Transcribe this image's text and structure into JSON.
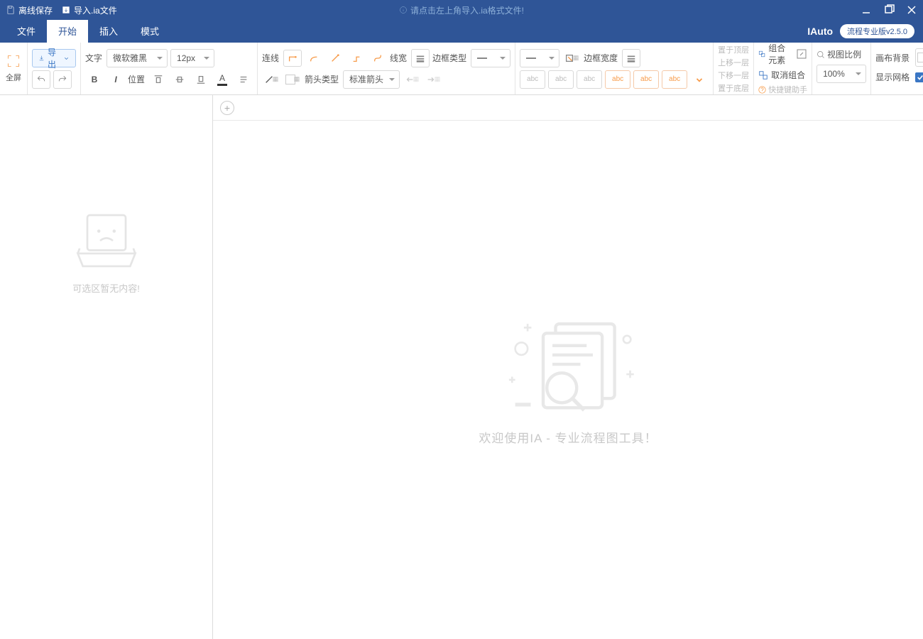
{
  "titlebar": {
    "offline_save": "离线保存",
    "import_file": "导入.ia文件",
    "hint": "请点击左上角导入.ia格式文件!"
  },
  "brand": "IAuto",
  "version": "流程专业版v2.5.0",
  "menu": {
    "file": "文件",
    "start": "开始",
    "insert": "插入",
    "mode": "模式"
  },
  "ribbon": {
    "fullscreen": "全屏",
    "export": "导出",
    "text_lbl": "文字",
    "font": "微软雅黑",
    "fontsize": "12px",
    "position": "位置",
    "line_lbl": "连线",
    "arrow_type_lbl": "箭头类型",
    "arrow_type_val": "标准箭头",
    "linewidth": "线宽",
    "border_type": "边框类型",
    "border_width": "边框宽度",
    "to_top": "置于顶层",
    "move_up": "上移一层",
    "move_down": "下移一层",
    "to_bottom": "置于底层",
    "group": "组合元素",
    "ungroup": "取消组合",
    "hotkey": "快捷键助手",
    "view_ratio": "视图比例",
    "zoom": "100%",
    "canvas_bg": "画布背景",
    "show_grid": "显示网格"
  },
  "sidepanel": {
    "empty": "可选区暂无内容!"
  },
  "canvas": {
    "welcome": "欢迎使用IA - 专业流程图工具！"
  }
}
